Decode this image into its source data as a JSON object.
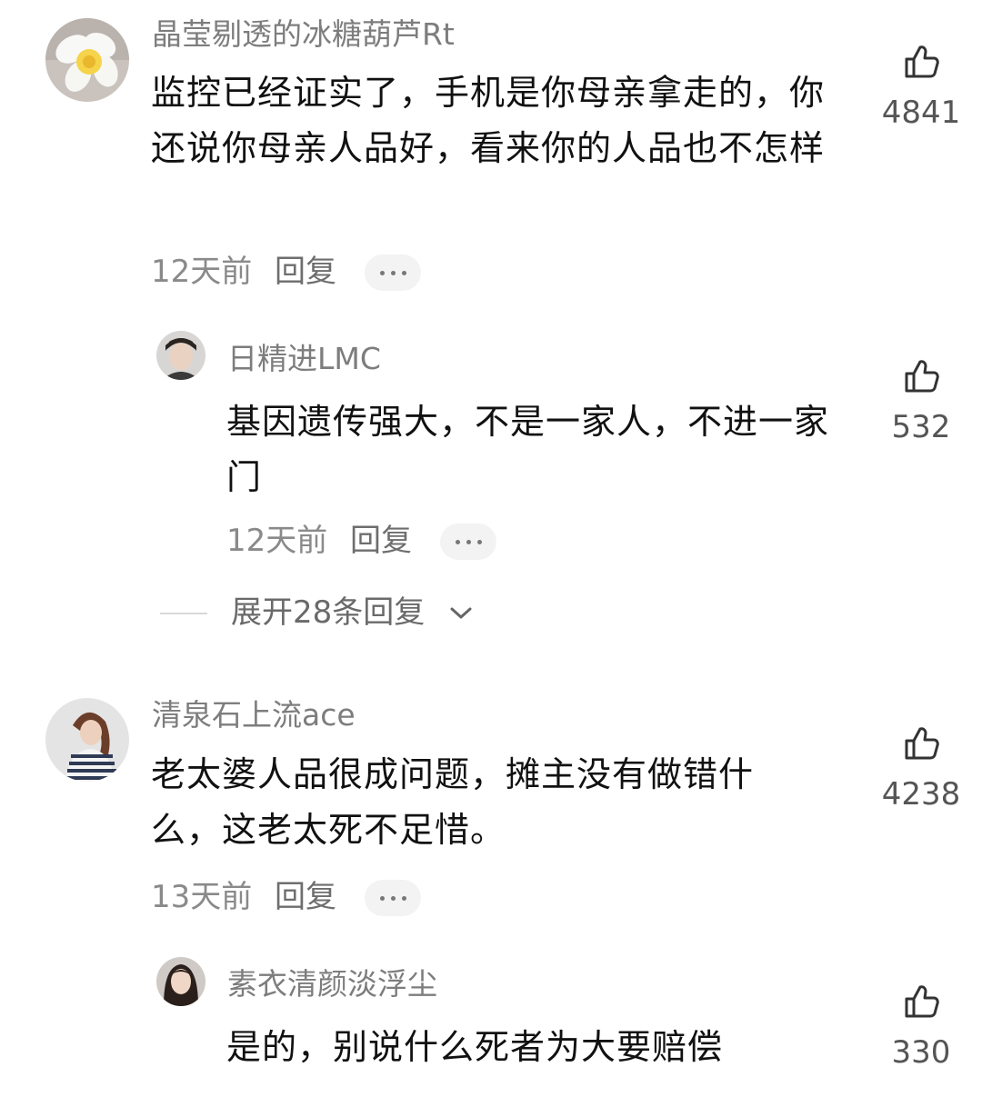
{
  "comments": [
    {
      "username": "晶莹剔透的冰糖葫芦Rt",
      "text": "监控已经证实了，手机是你母亲拿走的，你还说你母亲人品好，看来你的人品也不怎样",
      "time": "12天前",
      "reply_label": "回复",
      "likes": "4841",
      "avatar_icon": "plumeria-flower-avatar",
      "replies": [
        {
          "username": "日精进LMC",
          "text": "基因遗传强大，不是一家人，不进一家门",
          "time": "12天前",
          "reply_label": "回复",
          "likes": "532",
          "avatar_icon": "person-portrait-avatar"
        }
      ],
      "expand_label": "展开28条回复"
    },
    {
      "username": "清泉石上流ace",
      "text": "老太婆人品很成问题，摊主没有做错什么，这老太死不足惜。",
      "time": "13天前",
      "reply_label": "回复",
      "likes": "4238",
      "avatar_icon": "woman-striped-shirt-avatar",
      "replies": [
        {
          "username": "素衣清颜淡浮尘",
          "text": "是的，别说什么死者为大要赔偿",
          "likes": "330",
          "avatar_icon": "woman-portrait-avatar"
        }
      ]
    }
  ],
  "colors": {
    "name": "#7d7d7d",
    "text": "#111111",
    "meta": "#8a8a8a",
    "pill": "#f3f3f3"
  }
}
